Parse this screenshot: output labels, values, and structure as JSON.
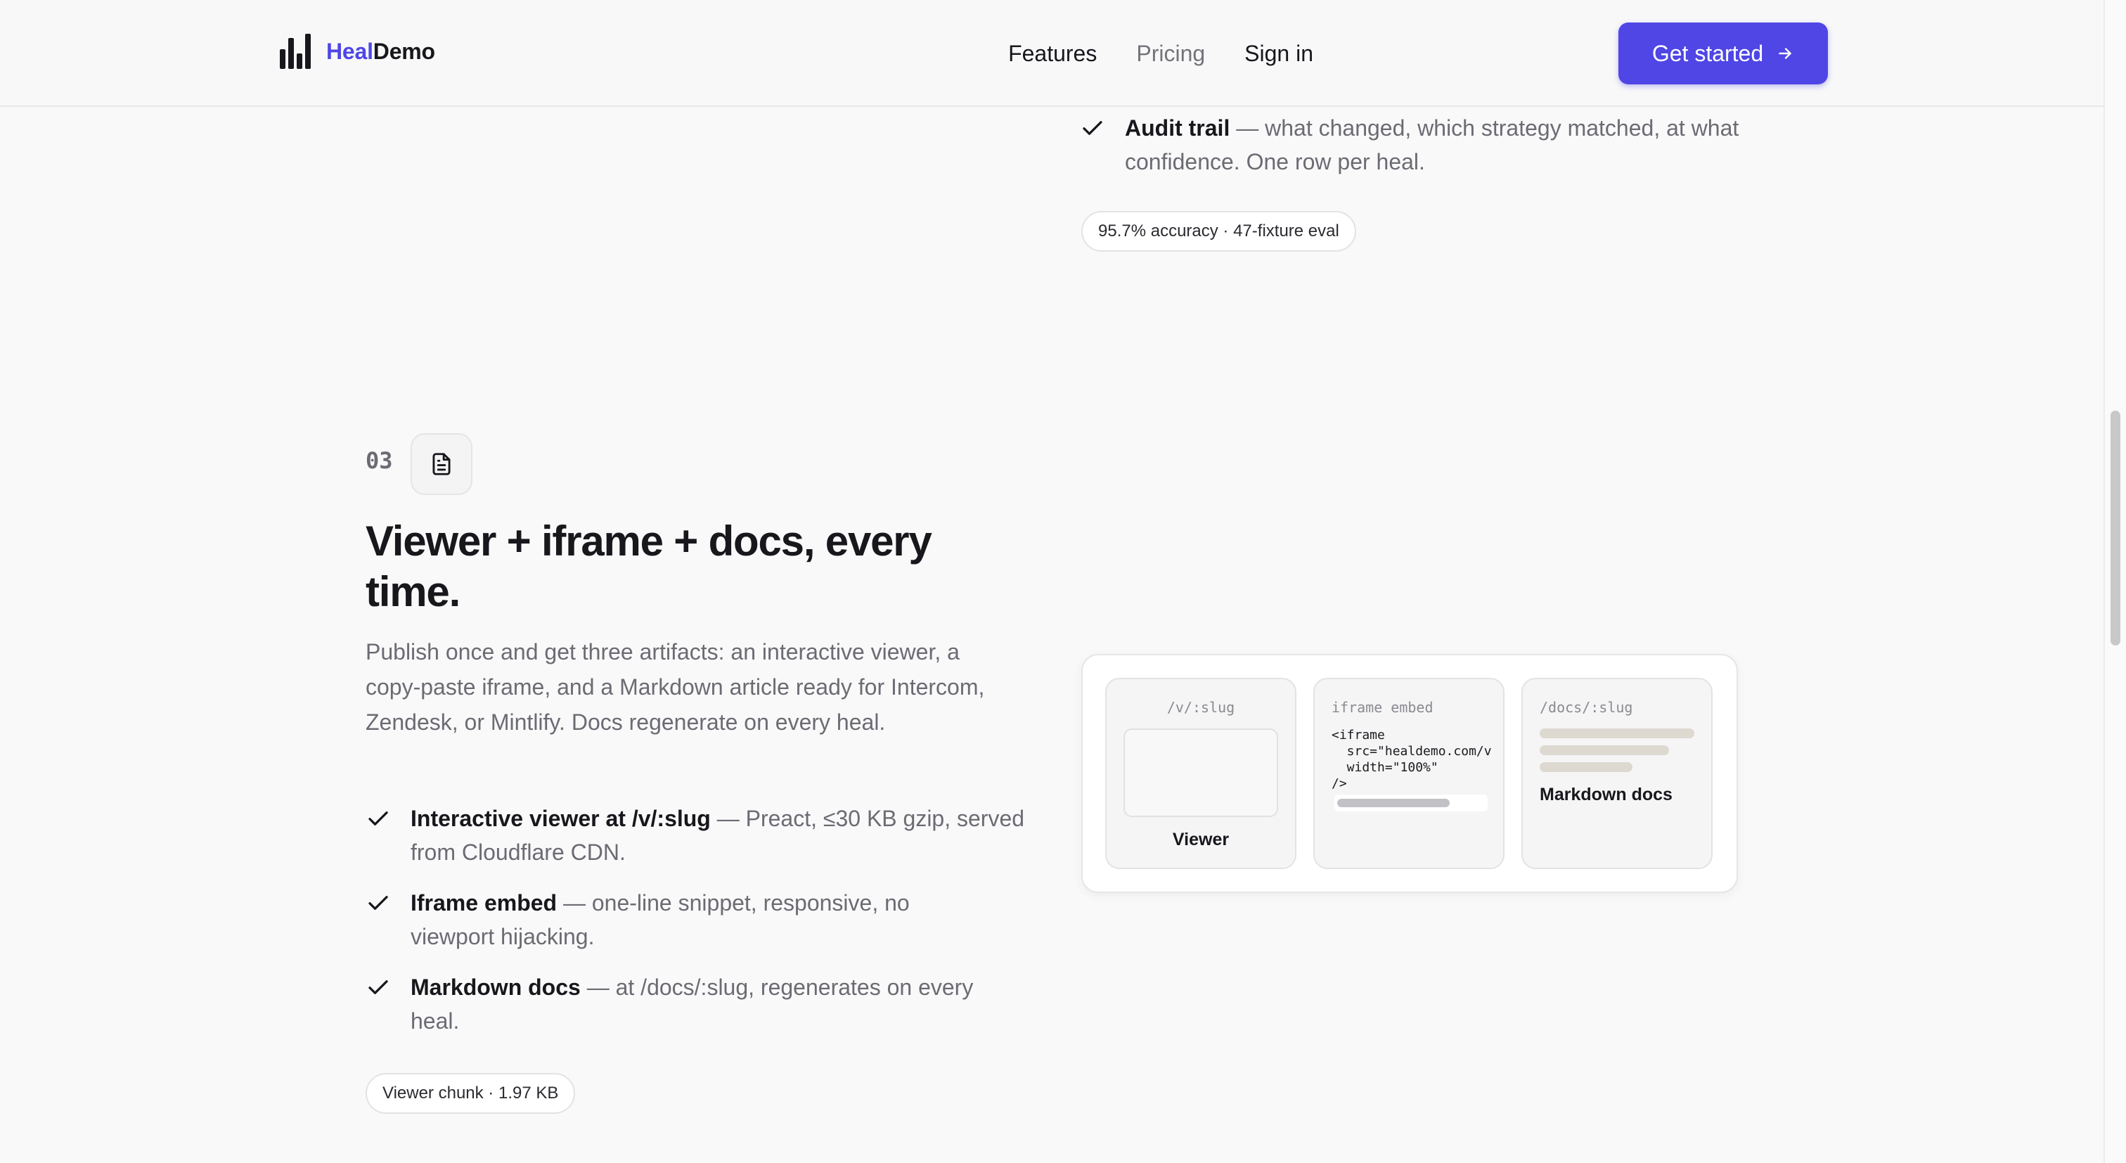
{
  "header": {
    "brand_accent": "Heal",
    "brand_rest": "Demo",
    "nav": {
      "features": "Features",
      "pricing": "Pricing",
      "sign_in": "Sign in"
    },
    "cta_label": "Get started",
    "accent_color": "#4f46e5"
  },
  "previous_section": {
    "feature": {
      "title": "Audit trail",
      "desc": " — what changed, which strategy matched, at what confidence. One row per heal."
    },
    "badge": "95.7% accuracy · 47-fixture eval"
  },
  "section": {
    "number": "03",
    "icon": "document-icon",
    "title": "Viewer + iframe + docs, every time.",
    "lede": "Publish once and get three artifacts: an interactive viewer, a copy-paste iframe, and a Markdown article ready for Intercom, Zendesk, or Mintlify. Docs regenerate on every heal.",
    "features": [
      {
        "title": "Interactive viewer at /v/:slug",
        "desc": " — Preact, ≤30 KB gzip, served from Cloudflare CDN."
      },
      {
        "title": "Iframe embed",
        "desc": " — one-line snippet, responsive, no viewport hijacking."
      },
      {
        "title": "Markdown docs",
        "desc": " — at /docs/:slug, regenerates on every heal."
      }
    ],
    "badge": "Viewer chunk · 1.97 KB",
    "artifacts": {
      "viewer": {
        "path": "/v/:slug",
        "label": "Viewer"
      },
      "iframe": {
        "path": "iframe embed",
        "code": "<iframe\n  src=\"healdemo.com/v\n  width=\"100%\"\n/>"
      },
      "docs": {
        "path": "/docs/:slug",
        "label": "Markdown docs"
      }
    }
  }
}
